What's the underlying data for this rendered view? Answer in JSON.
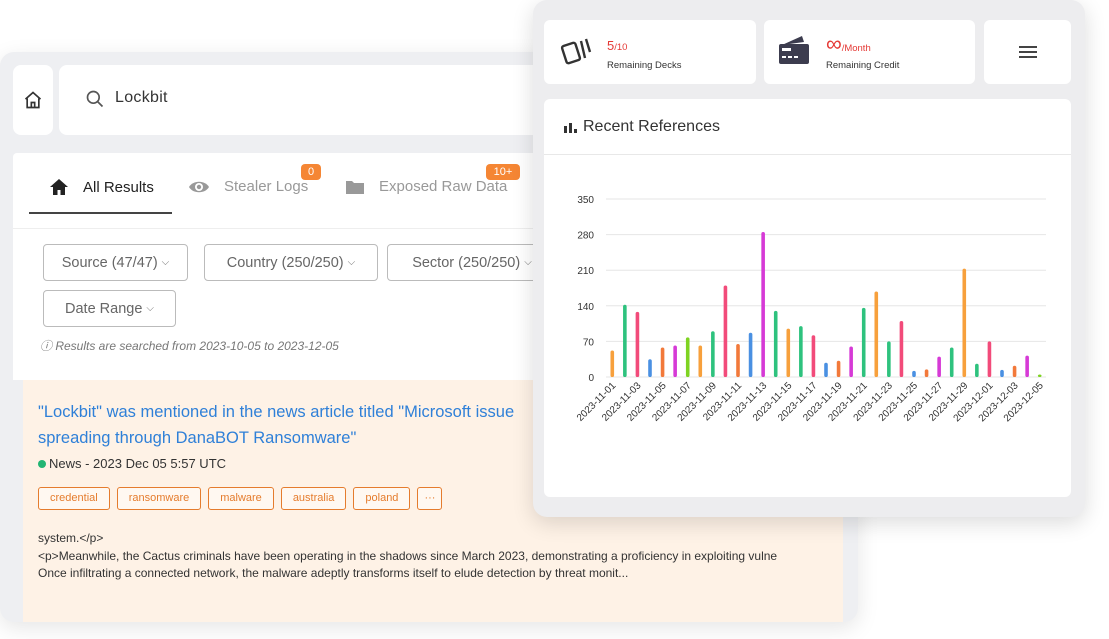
{
  "search": {
    "query": "Lockbit"
  },
  "tabs": [
    {
      "label": "All Results",
      "icon": "home-icon"
    },
    {
      "label": "Stealer Logs",
      "icon": "eye-icon",
      "badge": "0"
    },
    {
      "label": "Exposed Raw Data",
      "icon": "folder-icon",
      "badge": "10+"
    }
  ],
  "filters": {
    "source": "Source (47/47)",
    "country": "Country (250/250)",
    "sector": "Sector (250/250)",
    "date_range": "Date Range",
    "note": "ⓘ Results are searched from 2023-10-05 to 2023-12-05"
  },
  "result": {
    "title_line1": "\"Lockbit\" was mentioned in the news article titled \"Microsoft issue",
    "title_line2": "spreading through DanaBOT Ransomware\"",
    "meta": "News - 2023 Dec 05 5:57 UTC",
    "tags": [
      "credential",
      "ransomware",
      "malware",
      "australia",
      "poland",
      "···"
    ],
    "excerpt": [
      "system.</p>",
      "<p>Meanwhile, the Cactus criminals have been operating in the shadows since March 2023, demonstrating a proficiency in exploiting vulne",
      "Once infiltrating a connected network, the malware adeptly transforms itself to elude detection by threat monit..."
    ]
  },
  "stats": {
    "decks_value": "5",
    "decks_total": "/10",
    "decks_label": "Remaining Decks",
    "credit_value": "∞",
    "credit_unit": "/Month",
    "credit_label": "Remaining Credit"
  },
  "chart_title": "Recent References",
  "colors": {
    "accent_red": "#e53935",
    "badge_orange": "#f58634",
    "link_blue": "#2f80d8",
    "status_green": "#22b573"
  },
  "chart_data": {
    "type": "bar",
    "title": "Recent References",
    "ylim": [
      0,
      350
    ],
    "yticks": [
      0,
      70,
      140,
      210,
      280,
      350
    ],
    "xlabel": "",
    "ylabel": "",
    "grid": true,
    "legend": "none",
    "x_tick_labels": [
      "2023-11-01",
      "2023-11-03",
      "2023-11-05",
      "2023-11-07",
      "2023-11-09",
      "2023-11-11",
      "2023-11-13",
      "2023-11-15",
      "2023-11-17",
      "2023-11-19",
      "2023-11-21",
      "2023-11-23",
      "2023-11-25",
      "2023-11-27",
      "2023-11-29",
      "2023-12-01",
      "2023-12-03",
      "2023-12-05"
    ],
    "categories": [
      "2023-11-01",
      "2023-11-02",
      "2023-11-03",
      "2023-11-04",
      "2023-11-05",
      "2023-11-06",
      "2023-11-07",
      "2023-11-08",
      "2023-11-09",
      "2023-11-10",
      "2023-11-11",
      "2023-11-12",
      "2023-11-13",
      "2023-11-14",
      "2023-11-15",
      "2023-11-16",
      "2023-11-17",
      "2023-11-18",
      "2023-11-19",
      "2023-11-20",
      "2023-11-21",
      "2023-11-22",
      "2023-11-23",
      "2023-11-24",
      "2023-11-25",
      "2023-11-26",
      "2023-11-27",
      "2023-11-28",
      "2023-11-29",
      "2023-11-30",
      "2023-12-01",
      "2023-12-02",
      "2023-12-03",
      "2023-12-04",
      "2023-12-05"
    ],
    "values": [
      52,
      142,
      128,
      35,
      58,
      62,
      78,
      62,
      90,
      180,
      65,
      87,
      285,
      130,
      95,
      100,
      82,
      28,
      32,
      60,
      136,
      168,
      70,
      110,
      12,
      15,
      40,
      58,
      213,
      26,
      70,
      14,
      22,
      42,
      5
    ],
    "bar_colors": [
      "#f7a03c",
      "#2ec27e",
      "#f24b7a",
      "#4a90e2",
      "#f2793a",
      "#d63ad6",
      "#7ed321",
      "#f7a03c",
      "#2ec27e",
      "#f24b7a",
      "#f2793a",
      "#4a90e2",
      "#d63ad6",
      "#2ec27e",
      "#f7a03c",
      "#2ec27e",
      "#f24b7a",
      "#4a90e2",
      "#f2793a",
      "#d63ad6",
      "#2ec27e",
      "#f7a03c",
      "#2ec27e",
      "#f24b7a",
      "#4a90e2",
      "#f2793a",
      "#d63ad6",
      "#2ec27e",
      "#f7a03c",
      "#2ec27e",
      "#f24b7a",
      "#4a90e2",
      "#f2793a",
      "#d63ad6",
      "#7ed321"
    ]
  }
}
